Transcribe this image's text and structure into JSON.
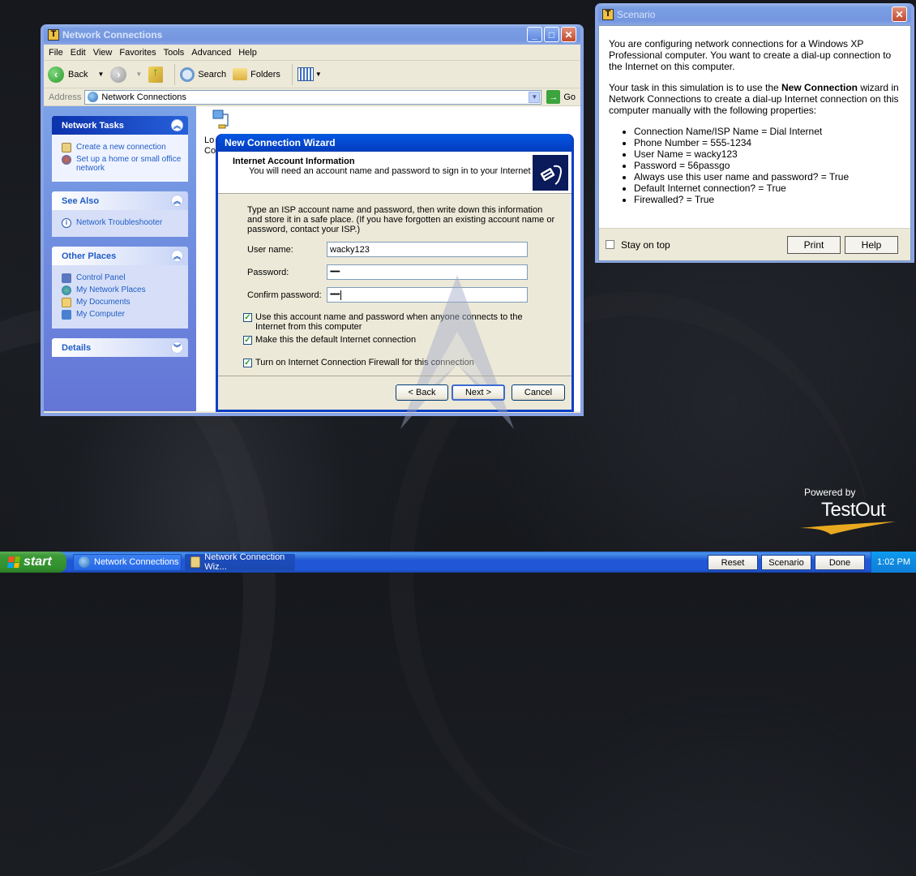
{
  "desktop": {
    "branding": {
      "powered_by": "Powered by",
      "logo_text": "TestOut"
    }
  },
  "network_connections_window": {
    "title": "Network Connections",
    "app_icon": "T",
    "menu": [
      "File",
      "Edit",
      "View",
      "Favorites",
      "Tools",
      "Advanced",
      "Help"
    ],
    "toolbar": {
      "back": "Back",
      "search": "Search",
      "folders": "Folders"
    },
    "address": {
      "label": "Address",
      "value": "Network Connections",
      "go": "Go"
    },
    "sidebar": {
      "network_tasks": {
        "title": "Network Tasks",
        "items": [
          "Create a new connection",
          "Set up a home or small office network"
        ]
      },
      "see_also": {
        "title": "See Also",
        "items": [
          "Network Troubleshooter"
        ]
      },
      "other_places": {
        "title": "Other Places",
        "items": [
          "Control Panel",
          "My Network Places",
          "My Documents",
          "My Computer"
        ]
      },
      "details": {
        "title": "Details"
      }
    },
    "content": {
      "lan_icon_label_line1": "Lo",
      "lan_icon_label_line2": "Co"
    }
  },
  "wizard": {
    "title": "New Connection Wizard",
    "header_title": "Internet Account Information",
    "header_subtitle": "You will need an account name and password to sign in to your Internet account.",
    "intro": "Type an ISP account name and password, then write down this information and store it in a safe place. (If you have forgotten an existing account name or password, contact your ISP.)",
    "fields": {
      "username": {
        "label": "User name:",
        "value": "wacky123"
      },
      "password": {
        "label": "Password:",
        "value": "••••••••"
      },
      "confirm": {
        "label": "Confirm password:",
        "value": "••••••••"
      }
    },
    "checkboxes": [
      {
        "label": "Use this account  name and password when anyone connects to the Internet from this computer",
        "checked": true
      },
      {
        "label": "Make this the default Internet connection",
        "checked": true
      },
      {
        "label": "Turn on Internet Connection Firewall for this connection",
        "checked": true
      }
    ],
    "buttons": {
      "back": "< Back",
      "next": "Next >",
      "cancel": "Cancel"
    }
  },
  "scenario_window": {
    "title": "Scenario",
    "app_icon": "T",
    "para1": "You are configuring network connections for a Windows XP Professional computer. You want to create a dial-up connection to the Internet on this computer.",
    "para2_before": "Your task in this simulation is to use the ",
    "para2_bold": "New Connection",
    "para2_after": " wizard in Network Connections to create a dial-up Internet connection on this computer manually with the following properties:",
    "properties": [
      "Connection Name/ISP Name = Dial Internet",
      "Phone Number = 555-1234",
      "User Name = wacky123",
      "Password = 56passgo",
      "Always use this user name and password? = True",
      "Default Internet connection? = True",
      "Firewalled? = True"
    ],
    "stay_on_top": {
      "label": "Stay on top",
      "checked": false
    },
    "buttons": {
      "print": "Print",
      "help": "Help"
    }
  },
  "taskbar": {
    "start": "start",
    "items": [
      "Network Connections",
      "Network Connection Wiz..."
    ],
    "buttons": {
      "reset": "Reset",
      "scenario": "Scenario",
      "done": "Done"
    },
    "clock": "1:02 PM"
  },
  "colors": {
    "xp_blue_active": "#0349d0",
    "xp_blue_inactive": "#7596e0",
    "taskbar": "#2157d7",
    "start_green": "#3c9a37",
    "link_blue": "#215dc6",
    "dialog_bg": "#ece9d8"
  }
}
